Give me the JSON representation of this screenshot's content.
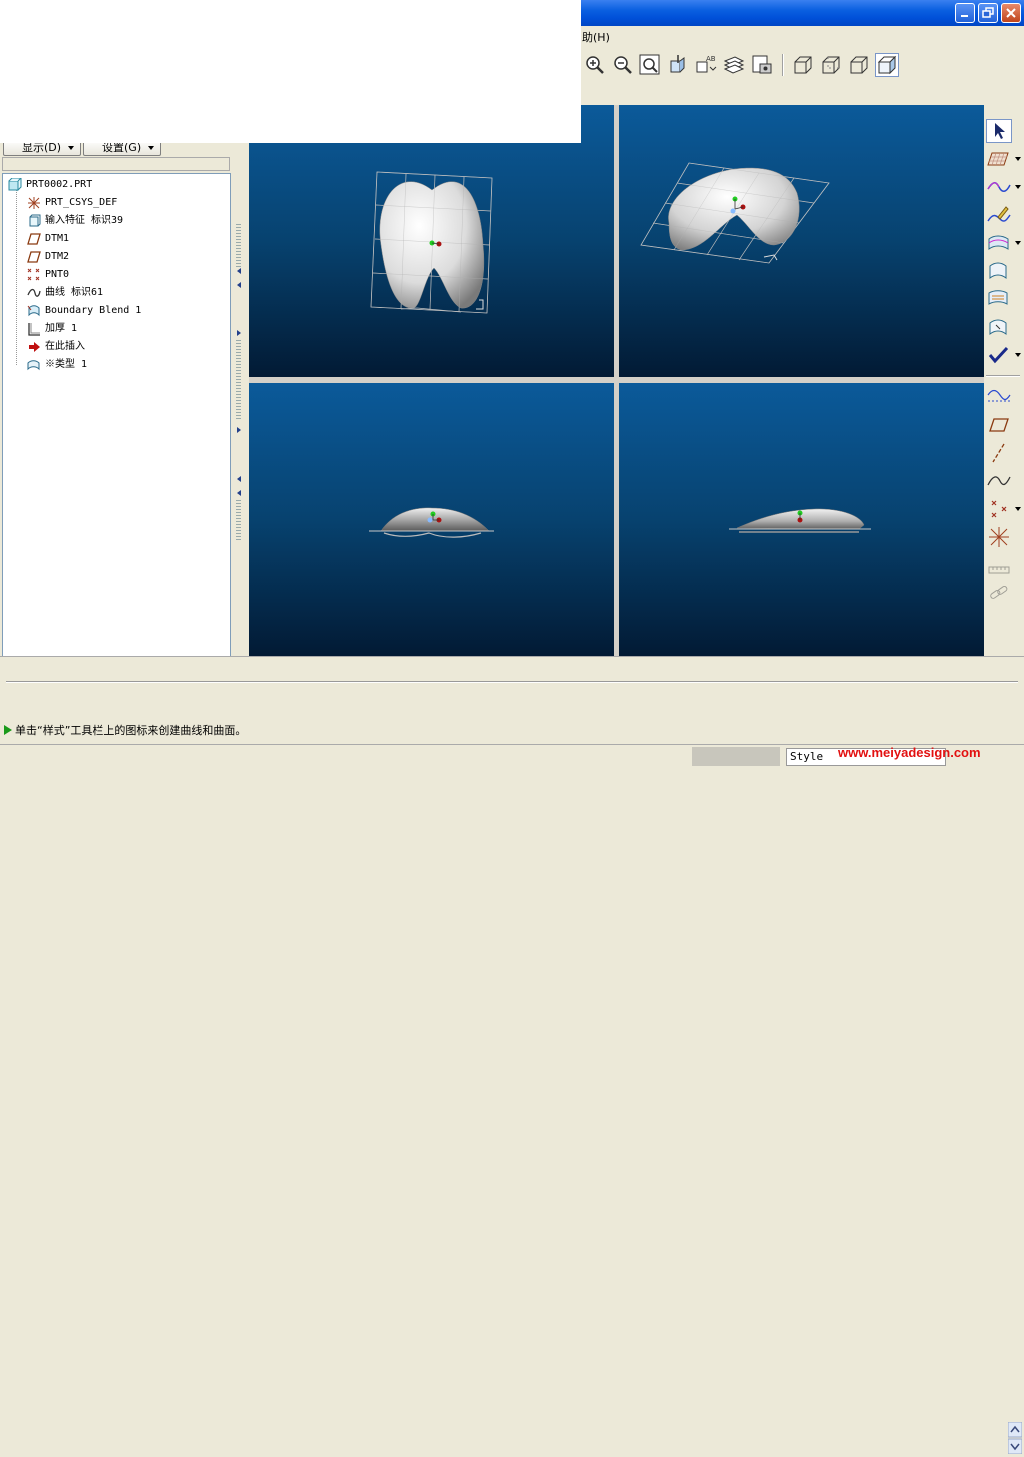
{
  "menubar": {
    "help_label": "助(H)"
  },
  "left_panel": {
    "show_button": "显示(D)",
    "settings_button": "设置(G)"
  },
  "tree": {
    "items": [
      {
        "label": "PRT0002.PRT",
        "icon": "part-icon"
      },
      {
        "label": "PRT_CSYS_DEF",
        "icon": "csys-icon"
      },
      {
        "label": "输入特征 标识39",
        "icon": "import-feature-icon"
      },
      {
        "label": "DTM1",
        "icon": "datum-plane-icon"
      },
      {
        "label": "DTM2",
        "icon": "datum-plane-icon"
      },
      {
        "label": "PNT0",
        "icon": "datum-point-icon"
      },
      {
        "label": "曲线 标识61",
        "icon": "curve-icon"
      },
      {
        "label": "Boundary Blend 1",
        "icon": "boundary-blend-icon"
      },
      {
        "label": "加厚 1",
        "icon": "thicken-icon"
      },
      {
        "label": "在此插入",
        "icon": "insert-here-arrow-icon"
      },
      {
        "label": "※类型 1",
        "icon": "style-feature-icon"
      }
    ]
  },
  "message": {
    "text": "单击“样式”工具栏上的图标来创建曲线和曲面。"
  },
  "status": {
    "style_field": "Style"
  },
  "watermark": {
    "text": "www.meiyadesign.com"
  },
  "colors": {
    "title_blue": "#0050d8",
    "viewport_top": "#0b5a9a",
    "viewport_bottom": "#021a34",
    "message_arrow": "#1a9a1a",
    "watermark": "#e21010"
  }
}
